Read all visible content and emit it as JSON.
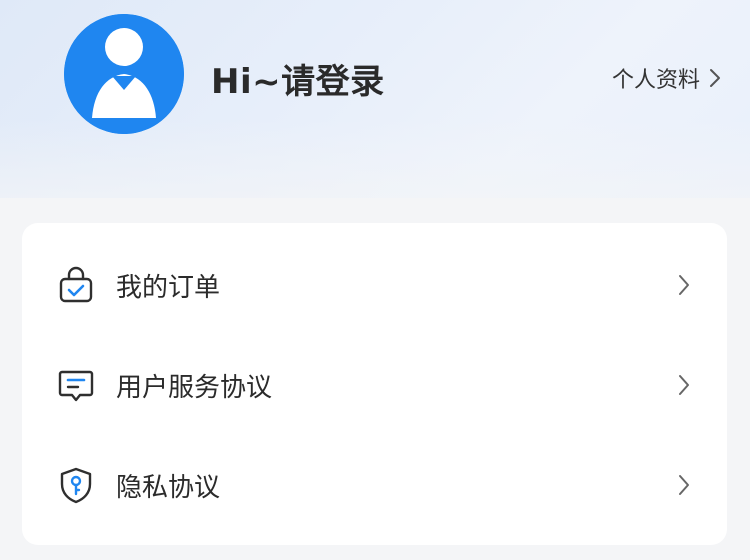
{
  "header": {
    "greeting": "Hi~请登录",
    "profile_link": "个人资料",
    "avatar_icon": "default-user-avatar",
    "accent_color": "#1f86f0"
  },
  "menu": {
    "items": [
      {
        "label": "我的订单",
        "icon": "shopping-bag-check-icon"
      },
      {
        "label": "用户服务协议",
        "icon": "message-document-icon"
      },
      {
        "label": "隐私协议",
        "icon": "shield-key-icon"
      }
    ]
  }
}
